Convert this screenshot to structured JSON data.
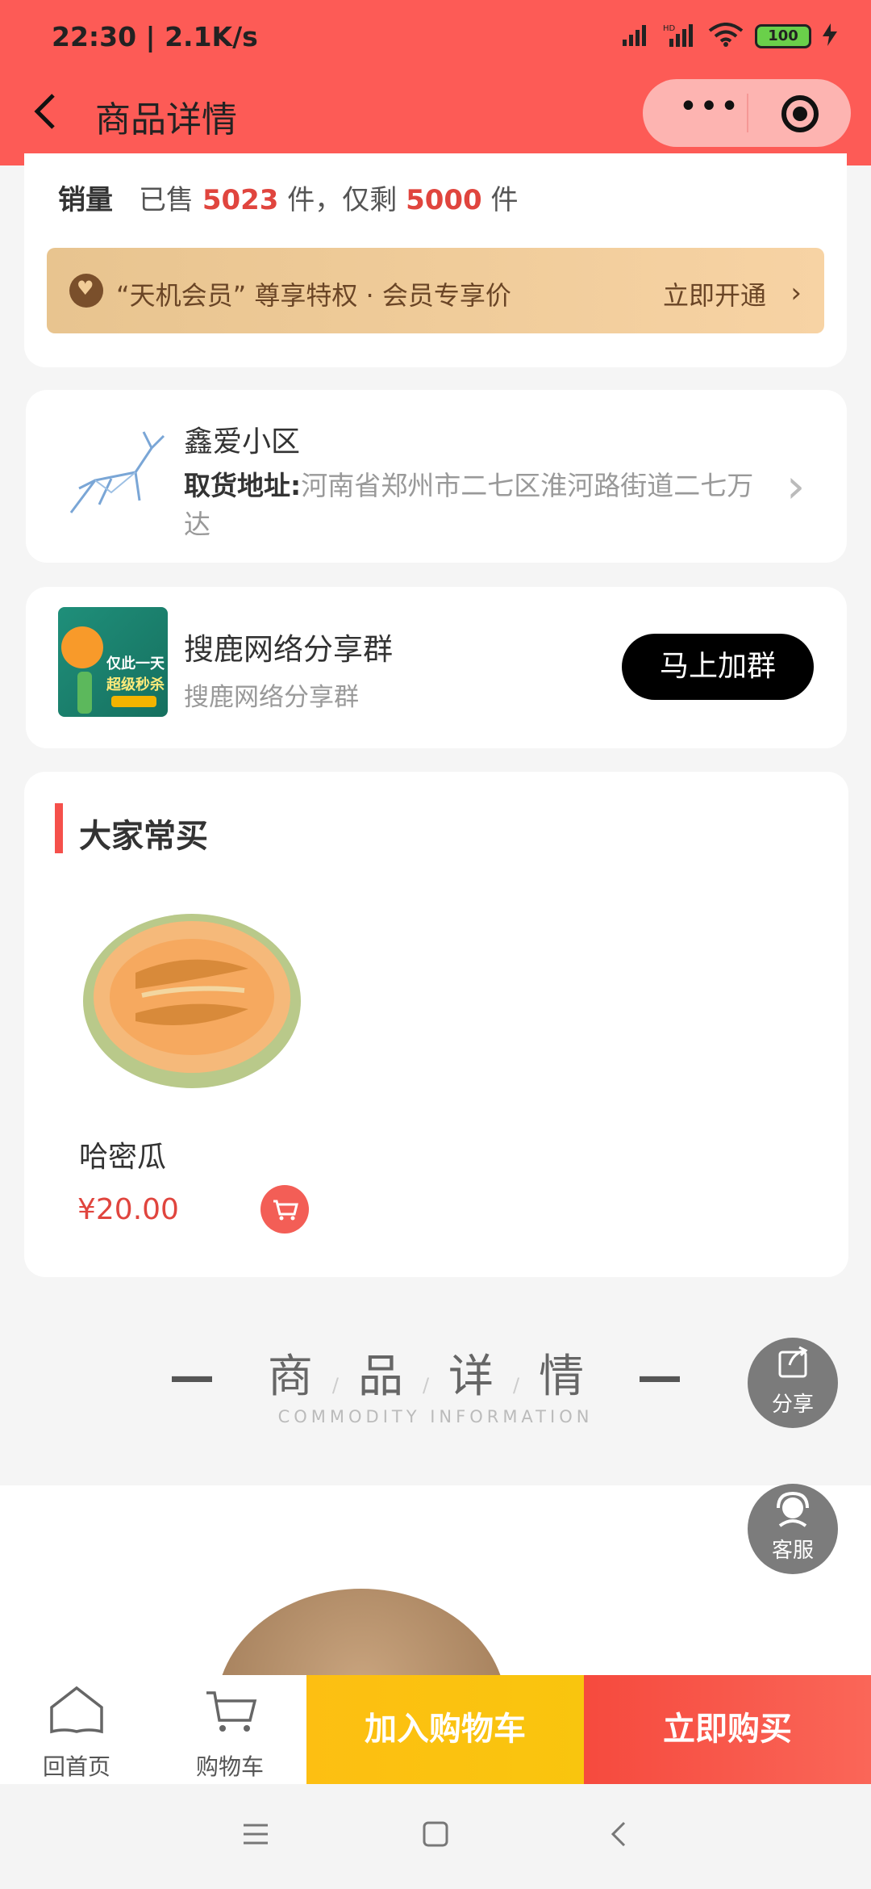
{
  "status_bar": {
    "time": "22:30 | 2.1K/s",
    "battery": "100"
  },
  "header": {
    "title": "商品详情",
    "menu_dots": "•••"
  },
  "sales": {
    "label": "销量",
    "prefix": "已售",
    "sold": "5023",
    "mid": "件，仅剩",
    "remaining": "5000",
    "suffix": "件"
  },
  "member_banner": {
    "text": "“天机会员” 尊享特权 · 会员专享价",
    "action": "立即开通"
  },
  "pickup": {
    "name": "鑫爱小区",
    "address_label": "取货地址:",
    "address": "河南省郑州市二七区淮河路街道二七万达"
  },
  "group": {
    "name": "搜鹿网络分享群",
    "subtitle": "搜鹿网络分享群",
    "join_label": "马上加群",
    "thumb_text_1": "仅此一天",
    "thumb_text_2": "超级秒杀"
  },
  "popular": {
    "title": "大家常买",
    "items": [
      {
        "name": "哈密瓜",
        "price": "¥20.00"
      }
    ]
  },
  "detail_heading": {
    "zh_1": "商",
    "zh_2": "品",
    "zh_3": "详",
    "zh_4": "情",
    "en": "COMMODITY INFORMATION"
  },
  "float_buttons": {
    "share": "分享",
    "service": "客服"
  },
  "bottom_bar": {
    "home": "回首页",
    "cart": "购物车",
    "add_to_cart": "加入购物车",
    "buy_now": "立即购买"
  },
  "colors": {
    "header_bg": "#fd5b56",
    "accent_red": "#e0453e",
    "cart_button": "#fdbf12",
    "buy_button": "#f64a3e"
  }
}
